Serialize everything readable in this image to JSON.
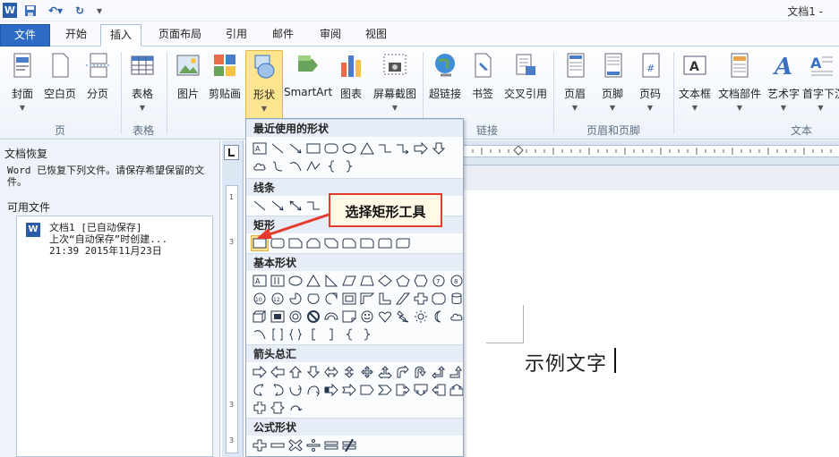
{
  "window": {
    "title": "文档1 -"
  },
  "quick_access": {
    "app_icon": "W",
    "save_icon": "save-icon",
    "undo_icon": "undo-icon",
    "redo_icon": "redo-icon",
    "customize_icon": "customize-icon"
  },
  "tabs": [
    {
      "label": "文件"
    },
    {
      "label": "开始"
    },
    {
      "label": "插入"
    },
    {
      "label": "页面布局"
    },
    {
      "label": "引用"
    },
    {
      "label": "邮件"
    },
    {
      "label": "审阅"
    },
    {
      "label": "视图"
    }
  ],
  "ribbon": {
    "buttons": [
      {
        "label": "封面"
      },
      {
        "label": "空白页"
      },
      {
        "label": "分页"
      },
      {
        "label": "表格"
      },
      {
        "label": "图片"
      },
      {
        "label": "剪贴画"
      },
      {
        "label": "形状"
      },
      {
        "label": "SmartArt"
      },
      {
        "label": "图表"
      },
      {
        "label": "屏幕截图"
      },
      {
        "label": "超链接"
      },
      {
        "label": "书签"
      },
      {
        "label": "交叉引用"
      },
      {
        "label": "页眉"
      },
      {
        "label": "页脚"
      },
      {
        "label": "页码"
      },
      {
        "label": "文本框"
      },
      {
        "label": "文档部件"
      },
      {
        "label": "艺术字"
      },
      {
        "label": "首字下沉"
      }
    ],
    "groups": [
      {
        "label": "页"
      },
      {
        "label": "表格"
      },
      {
        "label": "链接"
      },
      {
        "label": "页眉和页脚"
      },
      {
        "label": "文本"
      }
    ]
  },
  "recovery_pane": {
    "title": "文档恢复",
    "message": "Word 已恢复下列文件。请保存希望保留的文件。",
    "available_label": "可用文件",
    "file": {
      "name": "文档1  [已自动保存]",
      "detail": "上次“自动保存”时创建...",
      "time": "21:39 2015年11月23日"
    }
  },
  "shapes_menu": {
    "sections": [
      {
        "title": "最近使用的形状"
      },
      {
        "title": "线条"
      },
      {
        "title": "矩形"
      },
      {
        "title": "基本形状"
      },
      {
        "title": "箭头总汇"
      },
      {
        "title": "公式形状"
      }
    ]
  },
  "callout": {
    "text": "选择矩形工具",
    "color": "#e53b2f"
  },
  "document": {
    "text": "示例文字"
  },
  "colors": {
    "file_tab": "#2c6cc4",
    "selected": "#fde58f",
    "ribbon_border": "#b9cbe2"
  }
}
